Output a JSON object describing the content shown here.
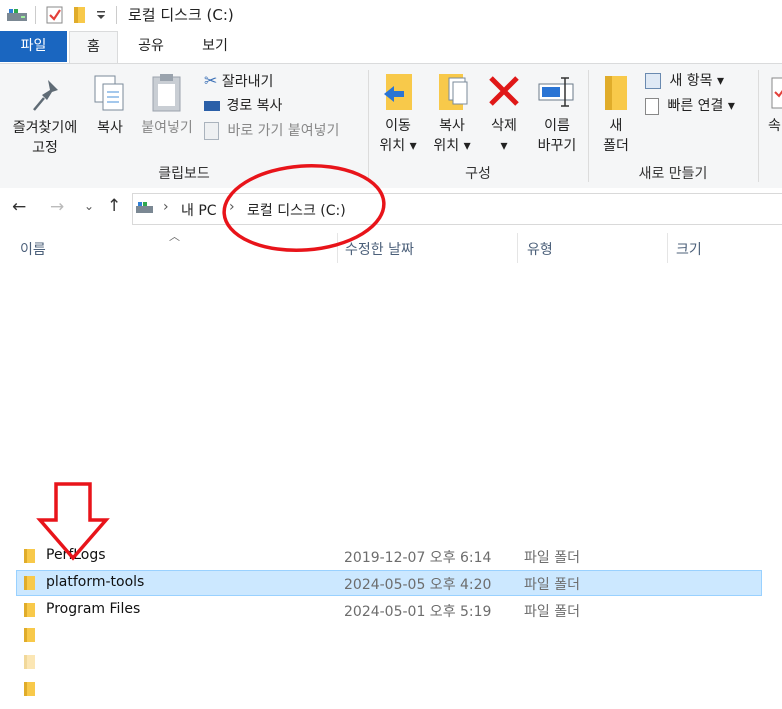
{
  "window": {
    "title": "로컬 디스크 (C:)"
  },
  "tabs": [
    {
      "label": "파일"
    },
    {
      "label": "홈"
    },
    {
      "label": "공유"
    },
    {
      "label": "보기"
    }
  ],
  "ribbon": {
    "clipboard": {
      "pin_label_line1": "즐겨찾기에",
      "pin_label_line2": "고정",
      "copy_label": "복사",
      "paste_label": "붙여넣기",
      "cut_label": "잘라내기",
      "copy_path_label": "경로 복사",
      "paste_shortcut_label": "바로 가기 붙여넣기",
      "group_label": "클립보드"
    },
    "organize": {
      "move_line1": "이동",
      "move_line2": "위치",
      "copyto_line1": "복사",
      "copyto_line2": "위치",
      "delete_label": "삭제",
      "rename_line1": "이름",
      "rename_line2": "바꾸기",
      "group_label": "구성"
    },
    "new": {
      "new_folder_line1": "새",
      "new_folder_line2": "폴더",
      "new_item_label": "새 항목",
      "easy_access_label": "빠른 연결",
      "group_label": "새로 만들기"
    },
    "partial_label": "속"
  },
  "breadcrumb": {
    "items": [
      "내 PC",
      "로컬 디스크 (C:)"
    ]
  },
  "columns": {
    "name": "이름",
    "modified": "수정한 날짜",
    "type": "유형",
    "size": "크기"
  },
  "files": [
    {
      "name": "PerfLogs",
      "modified": "2019-12-07 오후 6:14",
      "type": "파일 폴더"
    },
    {
      "name": "platform-tools",
      "modified": "2024-05-05 오후 4:20",
      "type": "파일 폴더",
      "selected": true
    },
    {
      "name": "Program Files",
      "modified": "2024-05-01 오후 5:19",
      "type": "파일 폴더"
    }
  ],
  "colors": {
    "file_tab": "#1a66c0",
    "selection": "#cce8ff",
    "annotation": "#e8141a",
    "folder": "#f8c94a"
  }
}
